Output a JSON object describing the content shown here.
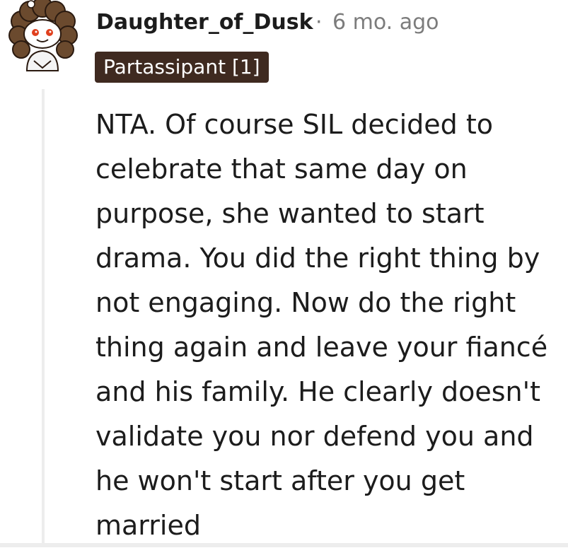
{
  "comment": {
    "author": "Daughter_of_Dusk",
    "separator": "·",
    "age": "6 mo. ago",
    "flair": "Partassipant [1]",
    "flair_color": "#3f2a20",
    "avatar_icon": "snoo-avatar-icon",
    "body": "NTA. Of course SIL decided to celebrate that same day on purpose, she wanted to start drama. You did the right thing by not engaging. Now do the right thing again and leave your fiancé and his family. He clearly doesn't validate you nor defend you and he won't start after you get married"
  }
}
